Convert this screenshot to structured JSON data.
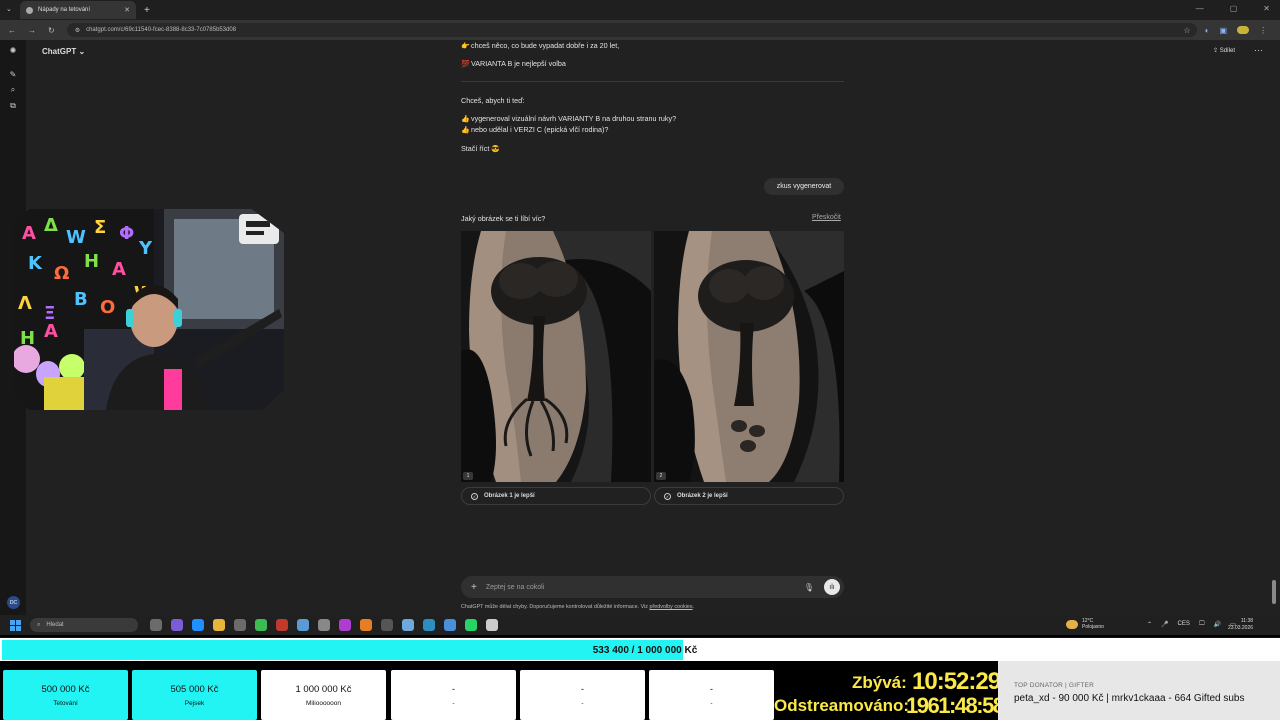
{
  "browser": {
    "tab_title": "Nápady na tetování",
    "tab_close": "✕",
    "new_tab": "+",
    "url": "chatgpt.com/c/69c11540-fcec-8388-8c33-7c0785b53d08",
    "nav": [
      "←",
      "→",
      "↻"
    ],
    "window_controls": [
      "—",
      "▢",
      "✕"
    ]
  },
  "chat": {
    "brand": "ChatGPT",
    "share": "Sdílet",
    "more": "···",
    "messages": [
      {
        "emoji": "👉",
        "text": "chceš něco, co bude vypadat dobře i za 20 let,"
      },
      {
        "emoji": "💯",
        "text": "VARIANTA B je nejlepší volba"
      },
      {
        "emoji": "",
        "text": "Chceš, abych ti teď:"
      },
      {
        "emoji": "👍",
        "text": "vygeneroval vizuální návrh VARIANTY B na druhou stranu ruky?"
      },
      {
        "emoji": "👍",
        "text": "nebo udělal i VERZI C (epická vlčí rodina)?"
      },
      {
        "emoji": "😎",
        "text": "Stačí říct"
      }
    ],
    "user_message": "zkus vygenerovat",
    "question": "Jaký obrázek se ti líbí víc?",
    "skip": "Přeskočit",
    "images": [
      {
        "number": "1",
        "choice": "Obrázek 1 je lepší"
      },
      {
        "number": "2",
        "choice": "Obrázek 2 je lepší"
      }
    ],
    "composer_placeholder": "Zeptej se na cokoli",
    "disclaimer_prefix": "ChatGPT může dělat chyby. Doporučujeme kontrolovat důležité informace. Viz ",
    "disclaimer_link": "předvolby cookies",
    "disclaimer_suffix": ".",
    "account_initials": "DC"
  },
  "taskbar": {
    "search_placeholder": "Hledat",
    "weather_temp": "12°C",
    "weather_desc": "Polojasno",
    "language": "CES",
    "time": "11:38",
    "date": "23.03.2026",
    "app_colors": [
      "#6b6b6b",
      "#7a5cd6",
      "#1e90ff",
      "#e8b53a",
      "#6b6b6b",
      "#3cba54",
      "#c0392b",
      "#5b9bd5",
      "#888888",
      "#b03bd0",
      "#e67e22",
      "#555555",
      "#6fa8dc",
      "#2c8fbf",
      "#4a90d9",
      "#25d366",
      "#cccccc"
    ]
  },
  "overlay": {
    "goal_label": "533 400 / 1 000 000 Kč",
    "goal_progress": 0.5334,
    "goals": [
      {
        "amount": "500 000 Kč",
        "label": "Tetování",
        "state": "done"
      },
      {
        "amount": "505 000 Kč",
        "label": "Pejsek",
        "state": "done"
      },
      {
        "amount": "1 000 000 Kč",
        "label": "Milioooooon",
        "state": "open"
      },
      {
        "amount": "-",
        "label": "-",
        "state": "open"
      },
      {
        "amount": "-",
        "label": "-",
        "state": "open"
      },
      {
        "amount": "-",
        "label": "-",
        "state": "open"
      }
    ],
    "remaining_label": "Zbývá:",
    "remaining_time": "10:52:29",
    "streamed_label": "Odstreamováno:",
    "streamed_time": "1961:48:58",
    "top_donor_heading": "TOP DONATOR | GIFTER",
    "top_donor_text": "peta_xd - 90 000 Kč | mrkv1ckaaa - 664 Gifted subs"
  },
  "colors": {
    "app_bg": "#212121",
    "goal_fill": "#22f4f4",
    "timer_yellow": "#fbe94a"
  }
}
